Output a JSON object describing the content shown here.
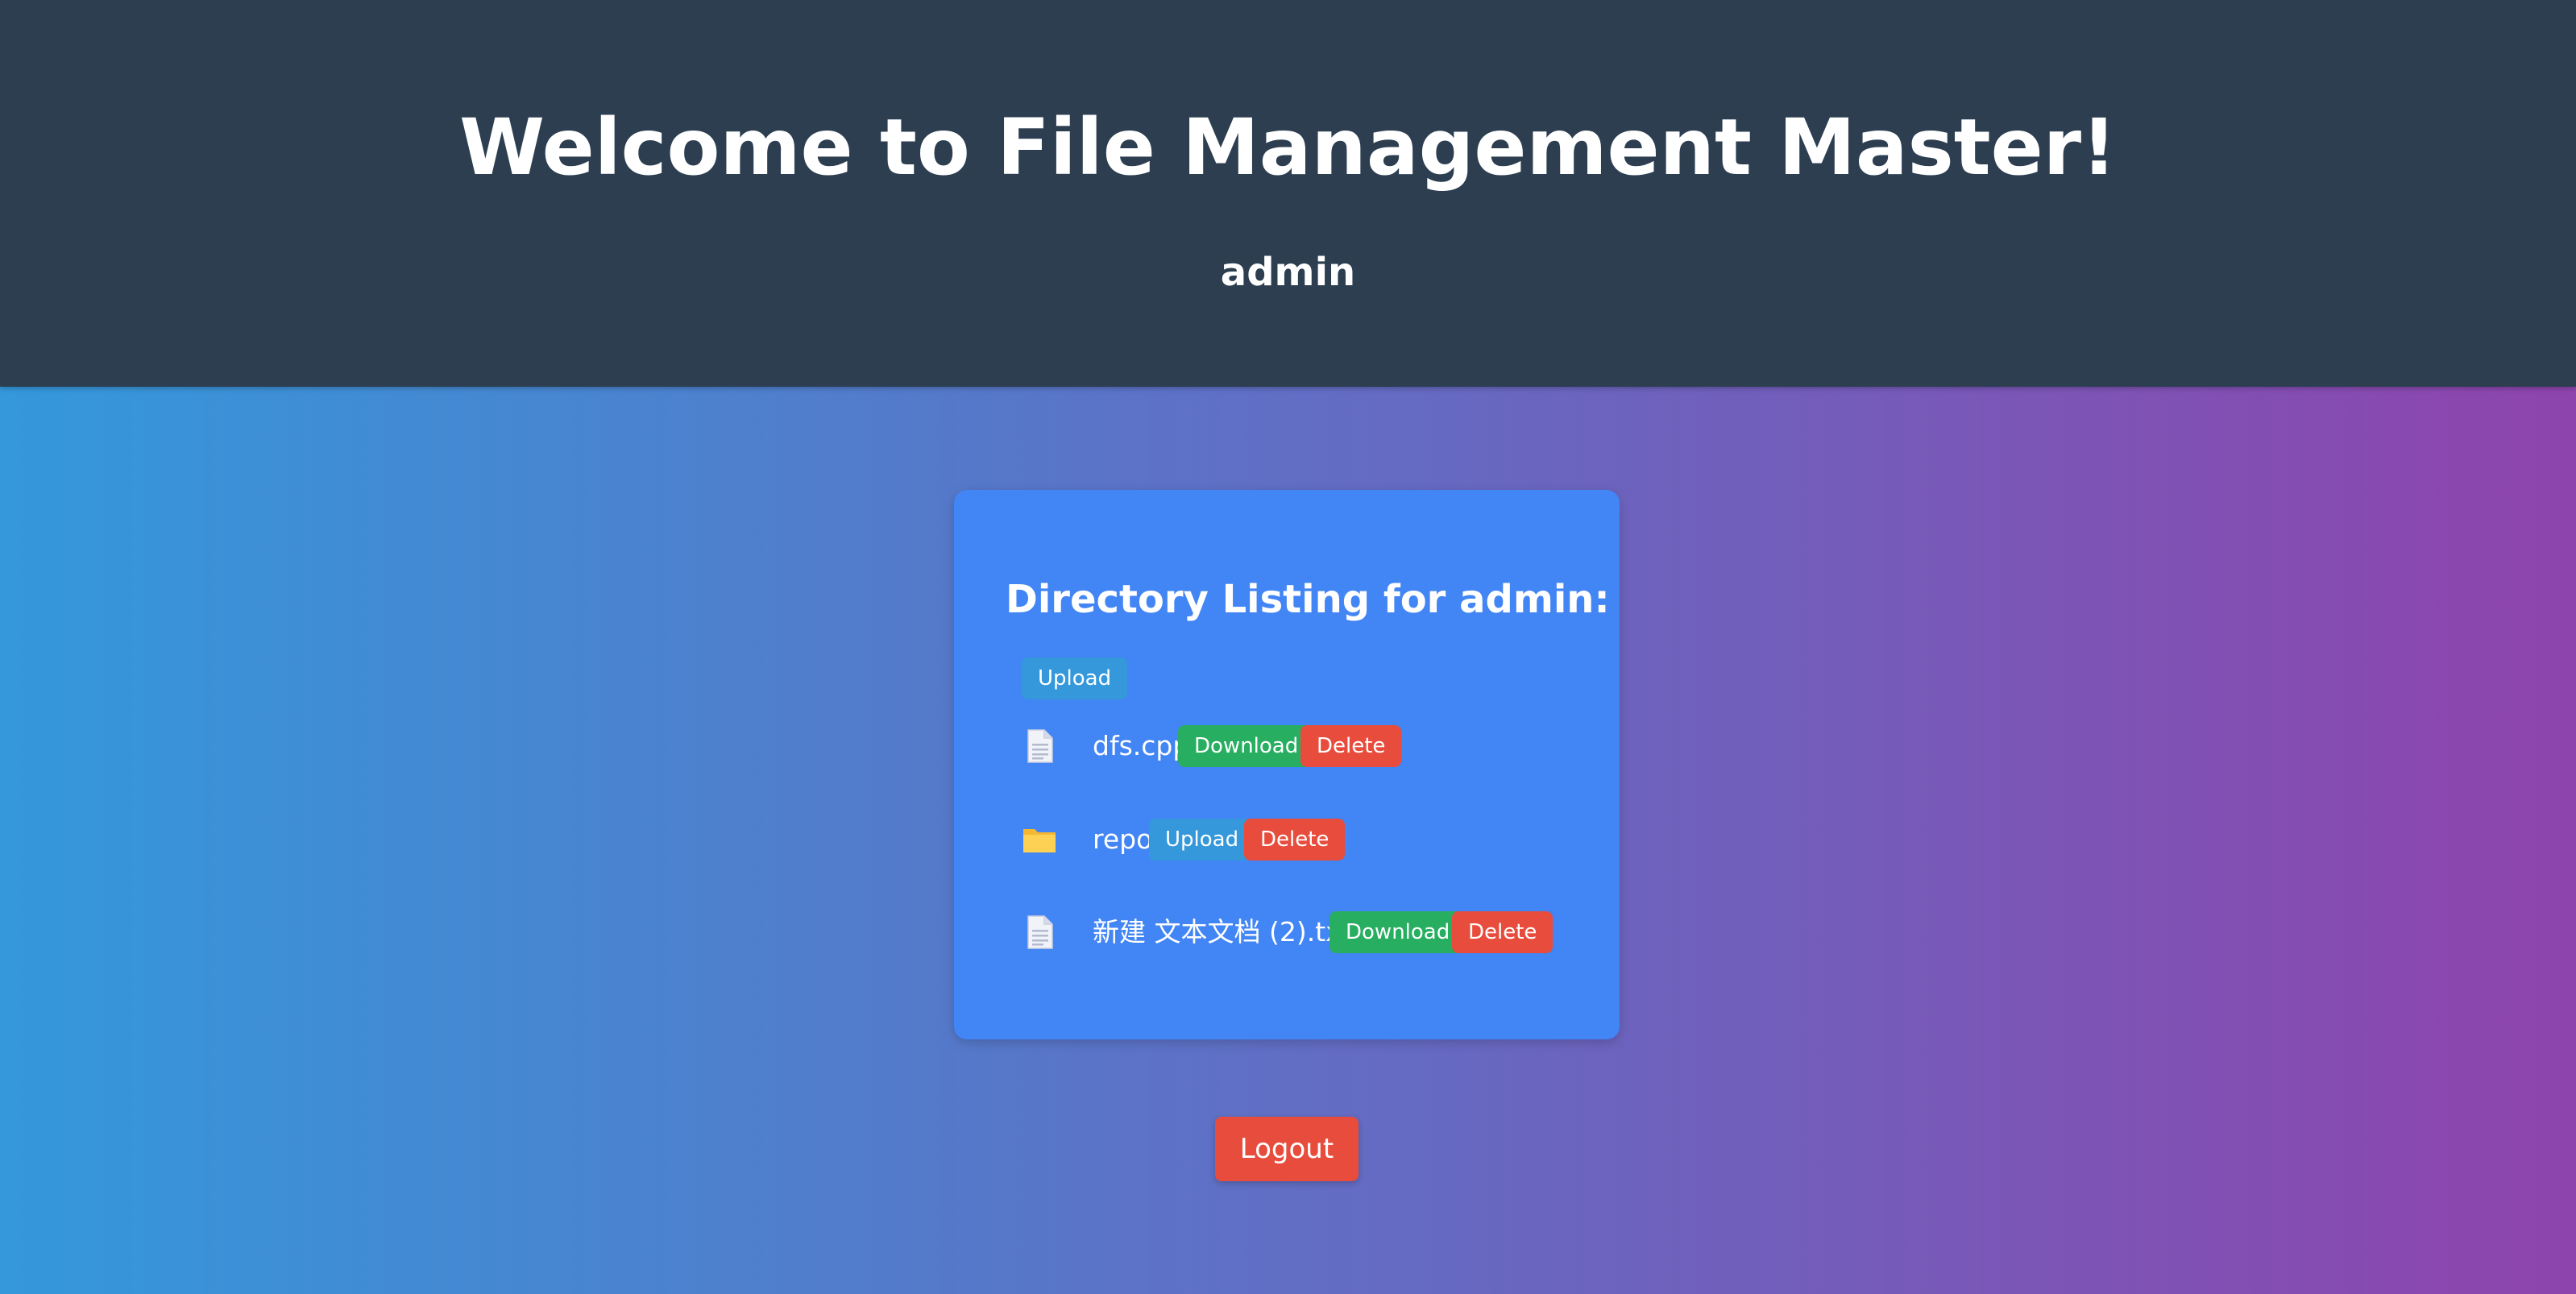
{
  "header": {
    "title": "Welcome to File Management Master!",
    "username": "admin"
  },
  "listing": {
    "heading": "Directory Listing for admin:",
    "upload_label": "Upload",
    "items": [
      {
        "name": "dfs.cpp",
        "type": "file",
        "icon": "file-icon",
        "action_label": "Download",
        "delete_label": "Delete"
      },
      {
        "name": "repo",
        "type": "folder",
        "icon": "folder-icon",
        "action_label": "Upload",
        "delete_label": "Delete"
      },
      {
        "name": "新建 文本文档 (2).txt",
        "type": "file",
        "icon": "file-icon",
        "action_label": "Download",
        "delete_label": "Delete"
      }
    ]
  },
  "logout_label": "Logout",
  "colors": {
    "header_bg": "#2c3e50",
    "card_bg": "#4285f4",
    "upload": "#3498db",
    "download": "#27ae60",
    "delete": "#e74c3c",
    "gradient_start": "#3498db",
    "gradient_end": "#8e44ad"
  }
}
